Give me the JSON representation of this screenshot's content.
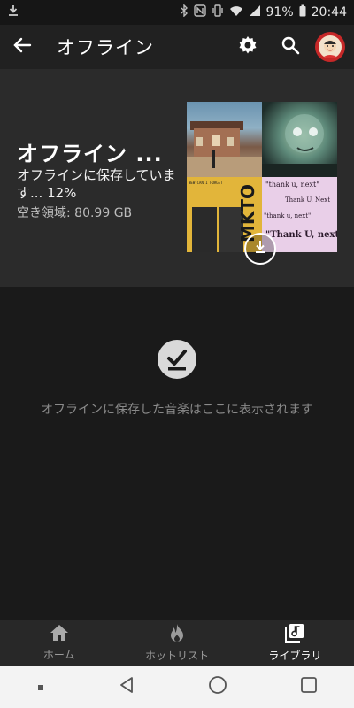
{
  "status_bar": {
    "battery": "91%",
    "time": "20:44",
    "icons": [
      "download-icon",
      "bluetooth-icon",
      "nfc-icon",
      "vibrate-icon",
      "wifi-icon",
      "signal-icon",
      "battery-icon"
    ]
  },
  "app_bar": {
    "title": "オフライン",
    "icons": [
      "back-arrow-icon",
      "settings-gear-icon",
      "search-icon",
      "avatar"
    ]
  },
  "offline_header": {
    "title": "オフライン ...",
    "status": "オフラインに保存していま す... 12%",
    "free_space": "空き領域: 80.99 GB",
    "progress_percent": 12,
    "album_art": {
      "tile2_text": "",
      "mkto": "MKTO",
      "thank_u_next": [
        "\"thank u, next\"",
        "Thank U, Next",
        "\"thank u, next\"",
        "\"Thank U, next\""
      ],
      "grid_text": "NEW CAN I FORGET"
    }
  },
  "empty_state": {
    "icon": "offline-check-icon",
    "message": "オフラインに保存した音楽はここに表示されます"
  },
  "bottom_nav": {
    "items": [
      {
        "label": "ホーム",
        "icon": "home-icon",
        "active": false
      },
      {
        "label": "ホットリスト",
        "icon": "flame-icon",
        "active": false
      },
      {
        "label": "ライブラリ",
        "icon": "library-icon",
        "active": true
      }
    ]
  },
  "colors": {
    "background": "#1a1a1a",
    "app_bar": "#212121",
    "header_card": "#2b2b2b",
    "bottom_nav": "#282828",
    "avatar_ring": "#c62828"
  }
}
